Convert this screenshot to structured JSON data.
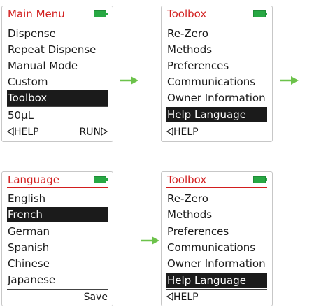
{
  "screen1": {
    "title": "Main Menu",
    "items": [
      "Dispense",
      "Repeat Dispense",
      "Manual Mode",
      "Custom",
      "Toolbox"
    ],
    "value": "50µL",
    "soft_left": "HELP",
    "soft_right": "RUN"
  },
  "screen2": {
    "title": "Toolbox",
    "items": [
      "Re-Zero",
      "Methods",
      "Preferences",
      "Communications",
      "Owner Information",
      "Help Language"
    ],
    "soft_left": "HELP"
  },
  "screen3": {
    "title": "Language",
    "items": [
      "English",
      "French",
      "German",
      "Spanish",
      "Chinese",
      "Japanese"
    ],
    "soft_right": "Save"
  },
  "screen4": {
    "title": "Toolbox",
    "items": [
      "Re-Zero",
      "Methods",
      "Preferences",
      "Communications",
      "Owner Information",
      "Help Language"
    ],
    "soft_left": "HELP"
  },
  "colors": {
    "accent": "#d21e1e",
    "battery": "#27a843",
    "selection": "#1b1b1b",
    "arrow": "#6cc24a"
  },
  "icons": [
    "battery-icon",
    "left-triangle-icon",
    "right-triangle-icon",
    "flow-arrow-icon"
  ]
}
